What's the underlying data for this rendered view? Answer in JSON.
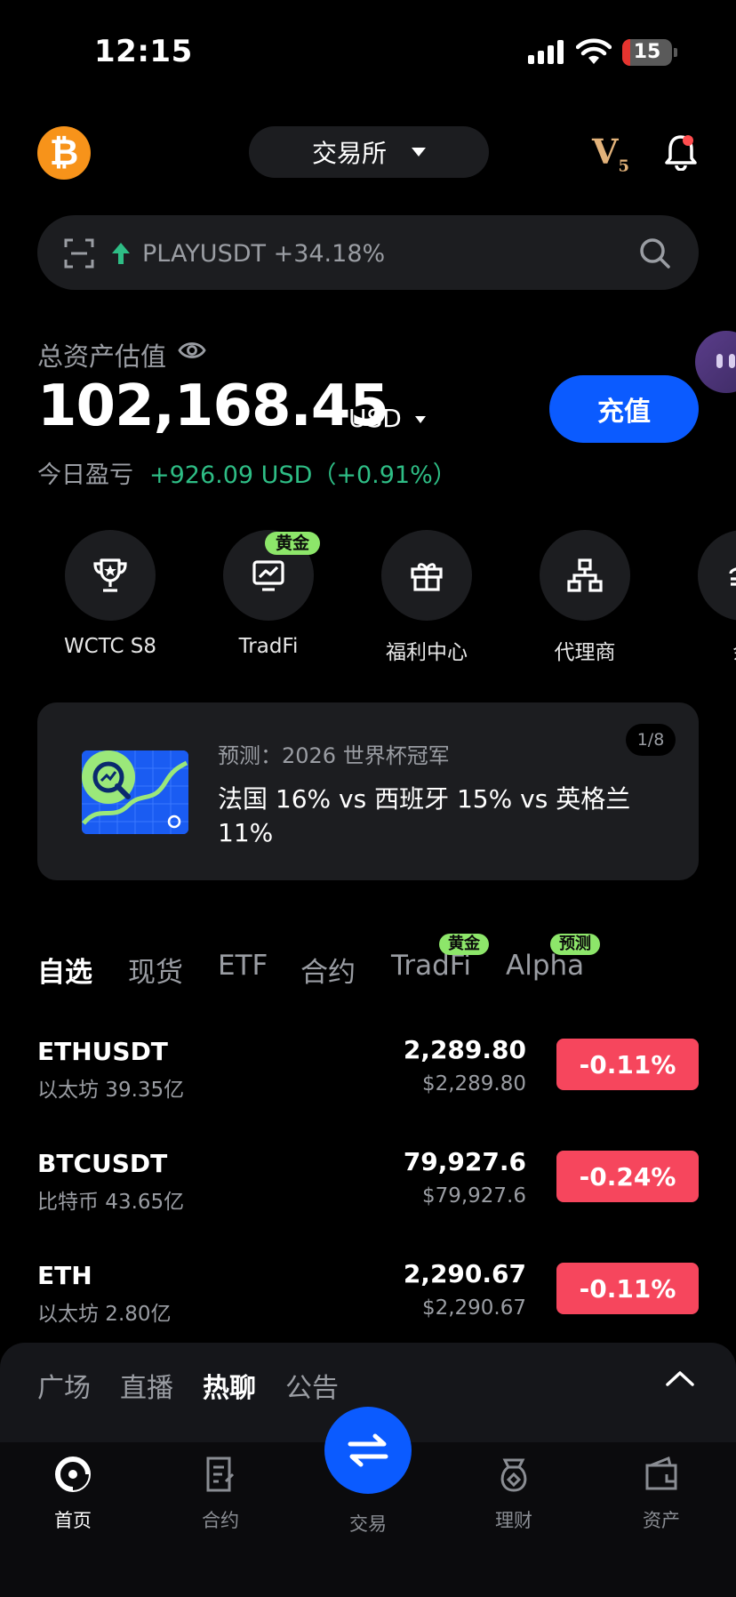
{
  "status_bar": {
    "time": "12:15",
    "battery": "15"
  },
  "header": {
    "exchange_label": "交易所",
    "vip_level": "V",
    "vip_num": "5"
  },
  "search": {
    "trend_text": "PLAYUSDT +34.18%"
  },
  "assets": {
    "label": "总资产估值",
    "value": "102,168.45",
    "unit": "USD",
    "pnl_label": "今日盈亏",
    "pnl_value": "+926.09 USD（+0.91%）",
    "deposit_label": "充值"
  },
  "shortcuts": [
    {
      "label": "WCTC S8",
      "icon": "trophy-icon"
    },
    {
      "label": "TradFi",
      "icon": "chart-monitor-icon",
      "badge": "黄金"
    },
    {
      "label": "福利中心",
      "icon": "gift-icon"
    },
    {
      "label": "代理商",
      "icon": "org-chart-icon"
    },
    {
      "label": "余",
      "icon": "coin-icon"
    }
  ],
  "promo": {
    "subtitle": "预测：2026 世界杯冠军",
    "title": "法国 16% vs 西班牙 15% vs 英格兰 11%",
    "page": "1/8"
  },
  "market_tabs": [
    {
      "label": "自选",
      "active": true
    },
    {
      "label": "现货"
    },
    {
      "label": "ETF"
    },
    {
      "label": "合约"
    },
    {
      "label": "TradFi",
      "badge": "黄金"
    },
    {
      "label": "Alpha",
      "badge": "预测"
    }
  ],
  "rows": [
    {
      "symbol": "ETHUSDT",
      "sub": "以太坊 39.35亿",
      "price": "2,289.80",
      "usd": "$2,289.80",
      "change": "-0.11%"
    },
    {
      "symbol": "BTCUSDT",
      "sub": "比特币 43.65亿",
      "price": "79,927.6",
      "usd": "$79,927.6",
      "change": "-0.24%"
    },
    {
      "symbol": "ETH",
      "sub": "以太坊 2.80亿",
      "price": "2,290.67",
      "usd": "$2,290.67",
      "change": "-0.11%"
    }
  ],
  "feed_tabs": [
    {
      "label": "广场"
    },
    {
      "label": "直播"
    },
    {
      "label": "热聊",
      "active": true
    },
    {
      "label": "公告"
    }
  ],
  "bottom_nav": [
    {
      "label": "首页",
      "icon": "home-icon",
      "active": true
    },
    {
      "label": "合约",
      "icon": "contract-icon"
    },
    {
      "label": "交易",
      "icon": "swap-icon"
    },
    {
      "label": "理财",
      "icon": "finance-icon"
    },
    {
      "label": "资产",
      "icon": "wallet-icon"
    }
  ],
  "colors": {
    "accent": "#0b5bff",
    "up": "#2ebd85",
    "down": "#f6465d",
    "badge": "#8de66a"
  }
}
